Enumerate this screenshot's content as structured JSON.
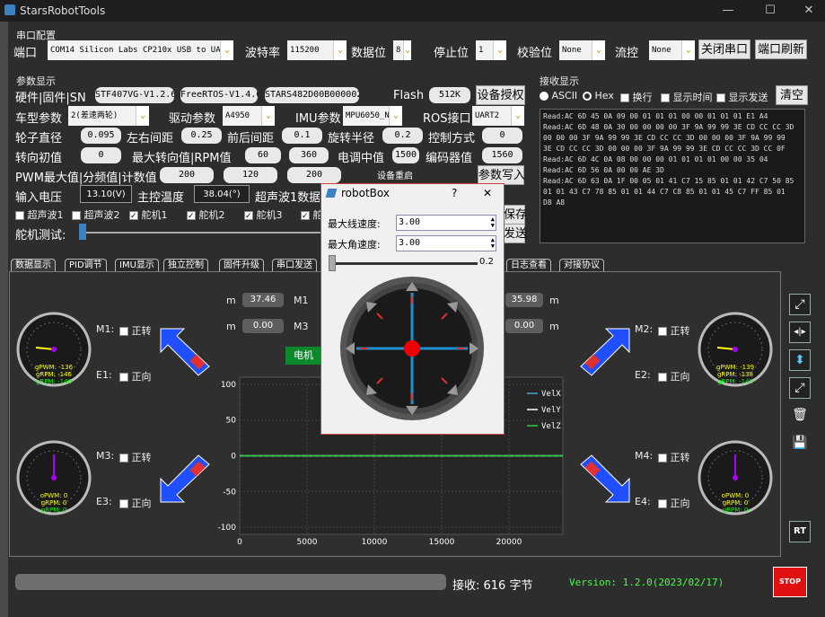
{
  "window": {
    "title": "StarsRobotTools",
    "minimize": "—",
    "maximize": "☐",
    "close": "✕"
  },
  "serial": {
    "group_title": "串口配置",
    "port_label": "端口",
    "port_value": "COM14 Silicon Labs CP210x USB to UART",
    "baud_label": "波特率",
    "baud_value": "115200",
    "databits_label": "数据位",
    "databits_value": "8",
    "stopbits_label": "停止位",
    "stopbits_value": "1",
    "parity_label": "校验位",
    "parity_value": "None",
    "flow_label": "流控",
    "flow_value": "None",
    "close_btn": "关闭串口",
    "refresh_btn": "端口刷新"
  },
  "params": {
    "group_title": "参数显示",
    "hw_label": "硬件|固件|SN",
    "hw_version": "STF407VG-V1.2.6",
    "fw_version": "FreeRTOS-V1.4.0",
    "sn": "STARS482D00B0000020",
    "flash_label": "Flash",
    "flash_value": "512K",
    "auth_btn": "设备授权",
    "car_type_label": "车型参数",
    "car_type_value": "2(差速两轮)",
    "drive_label": "驱动参数",
    "drive_value": "A4950",
    "imu_label": "IMU参数",
    "imu_value": "MPU6050_N",
    "ros_label": "ROS接口",
    "ros_value": "UART2",
    "wheel_label": "轮子直径",
    "wheel_value": "0.095",
    "lr_label": "左右间距",
    "lr_value": "0.25",
    "fb_label": "前后间距",
    "fb_value": "0.1",
    "radius_label": "旋转半径",
    "radius_value": "0.2",
    "ctrl_label": "控制方式",
    "ctrl_value": "0",
    "steer_label": "转向初值",
    "steer_value": "0",
    "maxsteer_label": "最大转向值|RPM值",
    "maxsteer_value": "60",
    "rpm_value": "360",
    "esc_label": "电调中值",
    "esc_value": "1500",
    "enc_label": "编码器值",
    "enc_value": "1560",
    "pwm_label": "PWM最大值|分频值|计数值",
    "pwm_max": "200",
    "pwm_div": "120",
    "pwm_cnt": "200",
    "restart_btn": "设备重启",
    "write_btn": "参数写入",
    "voltage_label": "输入电压",
    "voltage_value": "13.10(V)",
    "temp_label": "主控温度",
    "temp_value": "38.04(°)",
    "ultra_label": "超声波1数据",
    "checks": [
      {
        "label": "超声波1",
        "on": false
      },
      {
        "label": "超声波2",
        "on": false
      },
      {
        "label": "舵机1",
        "on": true
      },
      {
        "label": "舵机2",
        "on": true
      },
      {
        "label": "舵机3",
        "on": true
      },
      {
        "label": "舵",
        "on": true
      }
    ],
    "servo_test_label": "舵机测试:",
    "save_btn": "保存",
    "send_btn": "发送"
  },
  "receive": {
    "group_title": "接收显示",
    "ascii": "ASCII",
    "hex": "Hex",
    "newline": "换行",
    "show_time": "显示时间",
    "show_send": "显示发送",
    "clear_btn": "清空",
    "lines": [
      "Read:AC 6D 45 0A 09 00 01 01 01 00 00 01 01 01 E1 A4",
      "Read:AC 6D 48 0A 30 00 00 00 00 3F 9A 99 99 3E CD CC CC 3D",
      "00 00 00 3F 9A 99 99 3E CD CC CC 3D 00 00 00 3F 9A 99 99",
      "3E CD CC CC 3D 00 00 00 3F 9A 99 99 3E CD CC CC 3D CC 0F",
      "Read:AC 6D 4C 0A 08 00 00 00 01 01 01 01 00 00 35 04",
      "Read:AC 6D 56 0A 00 00 AE 3D",
      "Read:AC 6D 63 0A 1F 00 05 01 41 C7 15 85 01 01 42 C7 50 85",
      "01 01 43 C7 78 85 01 01 44 C7 C8 85 01 01 45 C7 FF 85 01",
      "D8 A8"
    ]
  },
  "tabs": [
    "数据显示",
    "PID调节",
    "IMU显示",
    "独立控制",
    "固件升级",
    "串口发送",
    "日志查看",
    "对接协议"
  ],
  "motors": {
    "m1": {
      "label": "M1:",
      "dir": "正转",
      "e_label": "E1:",
      "e_dir": "正向",
      "pwm": "gPWM: -136",
      "rpm": "gRPM: -146",
      "rpm2": "gRPM: -140",
      "readout_unit": "m",
      "readout": "37.46"
    },
    "m2": {
      "label": "M2:",
      "dir": "正转",
      "e_label": "E2:",
      "e_dir": "正向",
      "pwm": "gPWM: -139",
      "rpm": "gRPM: -138",
      "rpm2": "gRPM: -140",
      "readout": "35.98",
      "readout_unit": "m"
    },
    "m3": {
      "label": "M3:",
      "dir": "正转",
      "e_label": "E3:",
      "e_dir": "正向",
      "pwm": "oPWM: 0",
      "rpm": "gRPM: 0",
      "rpm2": "gRPM: 0",
      "readout": "0.00",
      "readout_unit": "m"
    },
    "m4": {
      "label": "M4:",
      "dir": "正转",
      "e_label": "E4:",
      "e_dir": "正向",
      "pwm": "oPWM: 0",
      "rpm": "gRPM: 0",
      "rpm2": "gRPM: 0",
      "readout": "0.00",
      "readout_unit": "m"
    },
    "center_m1": "M1",
    "center_m3": "M3",
    "electric_btn": "电机"
  },
  "chart_data": {
    "type": "line",
    "series": [
      {
        "name": "VelX",
        "color": "#3fa9d0",
        "values": [
          0,
          0
        ]
      },
      {
        "name": "VelY",
        "color": "#ffffff",
        "values": [
          0,
          0
        ]
      },
      {
        "name": "VelZ",
        "color": "#2ecc40",
        "values": [
          0,
          0
        ]
      }
    ],
    "x": [
      0,
      24000
    ],
    "xlim": [
      0,
      24000
    ],
    "ylim": [
      -110,
      110
    ],
    "xticks": [
      "0",
      "5000",
      "10000",
      "15000",
      "20000"
    ],
    "yticks": [
      "100",
      "50",
      "0",
      "-50",
      "-100"
    ],
    "grid": true,
    "legend": "top-right"
  },
  "dialog": {
    "title": "robotBox",
    "help": "?",
    "close": "✕",
    "max_linear_label": "最大线速度:",
    "max_linear_value": "3.00",
    "max_angular_label": "最大角速度:",
    "max_angular_value": "3.00",
    "slider_value": "0.2"
  },
  "status": {
    "recv_label": "接收: 616 字节",
    "version": "Version: 1.2.0(2023/02/17)",
    "stop": "STOP"
  }
}
